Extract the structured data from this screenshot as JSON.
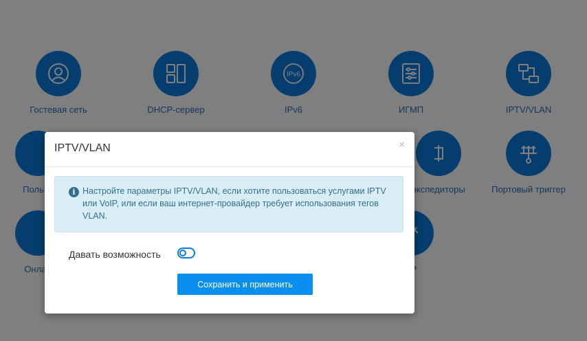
{
  "tiles": [
    {
      "label": "Гостевая сеть",
      "icon": "user-circle-icon"
    },
    {
      "label": "DHCP-сервер",
      "icon": "dhcp-blocks-icon"
    },
    {
      "label": "IPv6",
      "icon": "ipv6-icon",
      "icon_text": "IPv6"
    },
    {
      "label": "ИГМП",
      "icon": "sliders-icon"
    },
    {
      "label": "IPTV/VLAN",
      "icon": "iptv-vlan-icon"
    },
    {
      "label": "Пользо",
      "icon": "partial-icon"
    },
    {
      "label": "экспедиторы",
      "icon": "forwarder-icon"
    },
    {
      "label": "Портовый триггер",
      "icon": "port-trigger-icon"
    },
    {
      "label": "Онлай",
      "icon": "partial-icon"
    },
    {
      "label": "лР",
      "icon": "upnp-icon"
    }
  ],
  "modal": {
    "title": "IPTV/VLAN",
    "close_label": "×",
    "info_text": "Настройте параметры IPTV/VLAN, если хотите пользоваться услугами IPTV или VoIP, или если ваш интернет-провайдер требует использования тегов VLAN.",
    "info_icon": "i",
    "enable_label": "Давать возможность",
    "enable_state": false,
    "save_label": "Сохранить и применить"
  },
  "colors": {
    "accent": "#0a7ddc",
    "button": "#0a8ff0",
    "info_bg": "#d9edf7",
    "info_text": "#31708f",
    "overlay": "rgba(0,0,0,0.50)"
  }
}
